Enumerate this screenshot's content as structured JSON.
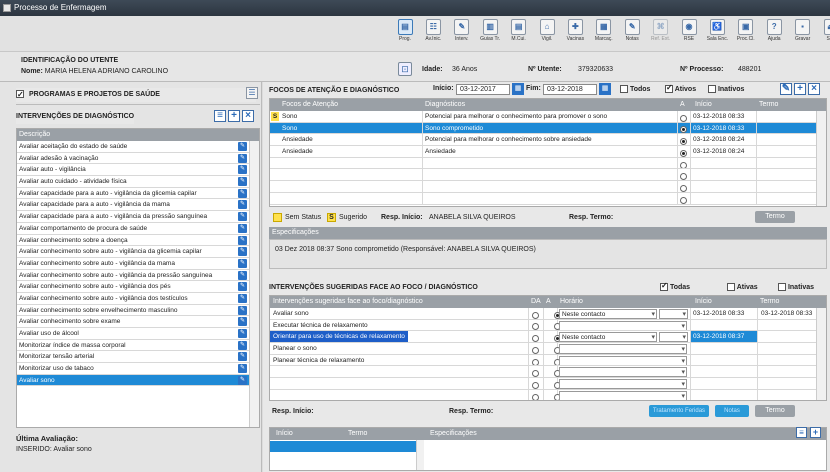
{
  "window": {
    "title": "Processo de Enfermagem"
  },
  "toolbar": [
    {
      "label": "Prog.",
      "icon": "program-icon",
      "state": "selected"
    },
    {
      "label": "Av.Inic.",
      "icon": "initial-eval-icon"
    },
    {
      "label": "Interv.",
      "icon": "interventions-icon"
    },
    {
      "label": "Guias Tr.",
      "icon": "guides-icon"
    },
    {
      "label": "M.Cui.",
      "icon": "care-model-icon"
    },
    {
      "label": "Vigil.",
      "icon": "vigilance-icon"
    },
    {
      "label": "Vacinas",
      "icon": "vaccine-icon"
    },
    {
      "label": "Marcaç.",
      "icon": "calendar-icon"
    },
    {
      "label": "Notas",
      "icon": "notes-icon"
    },
    {
      "label": "Ref. Ext.",
      "icon": "external-ref-icon",
      "state": "disabled"
    },
    {
      "label": "RSE",
      "icon": "rse-icon"
    },
    {
      "label": "Sala Enc.",
      "icon": "room-icon"
    },
    {
      "label": "Proc.Cl.",
      "icon": "clinical-process-icon"
    },
    {
      "label": "Ajuda",
      "icon": "help-icon"
    },
    {
      "label": "Gravar",
      "icon": "save-icon"
    },
    {
      "label": "Sair",
      "icon": "exit-icon"
    }
  ],
  "patient": {
    "section_title": "IDENTIFICAÇÃO DO UTENTE",
    "name_label": "Nome:",
    "name": "MARIA HELENA ADRIANO CAROLINO",
    "age_label": "Idade:",
    "age": "36 Anos",
    "utente_label": "Nº Utente:",
    "utente": "379320633",
    "processo_label": "Nº Processo:",
    "processo": "488201"
  },
  "left": {
    "programs_label": "PROGRAMAS E PROJETOS DE SAÚDE",
    "interventions_title": "INTERVENÇÕES DE DIAGNÓSTICO",
    "col_desc": "Descrição",
    "items": [
      "Avaliar aceitação do estado de saúde",
      "Avaliar adesão à vacinação",
      "Avaliar auto - vigilância",
      "Avaliar auto cuidado - atividade física",
      "Avaliar capacidade para a auto - vigilância da glicemia capilar",
      "Avaliar capacidade para a auto - vigilância da mama",
      "Avaliar capacidade para a auto - vigilância da pressão sanguínea",
      "Avaliar comportamento de procura de saúde",
      "Avaliar conhecimento sobre a doença",
      "Avaliar conhecimento sobre auto - vigilância da glicemia capilar",
      "Avaliar conhecimento sobre auto - vigilância da mama",
      "Avaliar conhecimento sobre auto - vigilância da pressão sanguínea",
      "Avaliar conhecimento sobre auto - vigilância dos pés",
      "Avaliar conhecimento sobre auto - vigilância dos testículos",
      "Avaliar conhecimento sobre envelhecimento masculino",
      "Avaliar conhecimento sobre exame",
      "Avaliar uso de álcool",
      "Monitorizar índice de massa corporal",
      "Monitorizar tensão arterial",
      "Monitorizar uso de tabaco",
      "Avaliar sono"
    ],
    "selected_index": 20,
    "last_eval_label": "Última Avaliação:",
    "last_eval_value": "INSERIDO: Avaliar sono"
  },
  "focos": {
    "title": "FOCOS DE ATENÇÃO E DIAGNÓSTICO",
    "inicio_label": "Início:",
    "inicio": "03-12-2017",
    "fim_label": "Fim:",
    "fim": "03-12-2018",
    "todos_label": "Todos",
    "ativos_label": "Ativos",
    "inativos_label": "Inativos",
    "cols": {
      "foco": "Focos de Atenção",
      "diag": "Diagnósticos",
      "a": "A",
      "inicio": "Início",
      "termo": "Termo"
    },
    "rows": [
      {
        "flag": "S",
        "foco": "Sono",
        "diag": "Potencial para melhorar o conhecimento para promover o sono",
        "active": false,
        "inicio": "03-12-2018 08:33",
        "termo": ""
      },
      {
        "flag": "",
        "foco": "Sono",
        "diag": "Sono comprometido",
        "active": true,
        "inicio": "03-12-2018 08:33",
        "termo": ""
      },
      {
        "flag": "",
        "foco": "Ansiedade",
        "diag": "Potencial para melhorar o conhecimento sobre ansiedade",
        "active": true,
        "inicio": "03-12-2018 08:24",
        "termo": ""
      },
      {
        "flag": "",
        "foco": "Ansiedade",
        "diag": "Ansiedade",
        "active": true,
        "inicio": "03-12-2018 08:24",
        "termo": ""
      }
    ],
    "selected_index": 1,
    "legend_sem": "Sem Status",
    "legend_sug": "Sugerido",
    "resp_inicio_label": "Resp. Início:",
    "resp_inicio": "ANABELA SILVA QUEIROS",
    "resp_termo_label": "Resp. Termo:",
    "termo_btn": "Termo",
    "espec_label": "Especificações",
    "espec_text": "03 Dez 2018 08:37  Sono comprometido  (Responsável: ANABELA SILVA QUEIROS)"
  },
  "sugeridas": {
    "title": "INTERVENÇÕES SUGERIDAS FACE AO FOCO / DIAGNÓSTICO",
    "todas_label": "Todas",
    "ativas_label": "Ativas",
    "inativas_label": "Inativas",
    "cols": {
      "desc": "Intervenções sugeridas face ao foco/diagnóstico",
      "da": "DA",
      "a": "A",
      "horario": "Horário",
      "inicio": "Início",
      "termo": "Termo"
    },
    "rows": [
      {
        "desc": "Avaliar sono",
        "horario": "Neste contacto",
        "inicio": "03-12-2018 08:33",
        "termo": "03-12-2018 08:33"
      },
      {
        "desc": "Executar técnica de relaxamento",
        "horario": "",
        "inicio": "",
        "termo": ""
      },
      {
        "desc": "Orientar para uso de técnicas de relaxamento",
        "horario": "Neste contacto",
        "inicio": "03-12-2018 08:37",
        "termo": ""
      },
      {
        "desc": "Planear o sono",
        "horario": "",
        "inicio": "",
        "termo": ""
      },
      {
        "desc": "Planear técnica de relaxamento",
        "horario": "",
        "inicio": "",
        "termo": ""
      }
    ],
    "selected_index": 2,
    "resp_inicio_label": "Resp. Início:",
    "resp_termo_label": "Resp. Termo:",
    "btn_ativ": "Tratamento Feridas",
    "btn_notas": "Notas",
    "btn_termo": "Termo"
  },
  "bottom": {
    "cols": {
      "inicio": "Início",
      "termo": "Termo",
      "espec": "Especificações"
    }
  },
  "colors": {
    "selection": "#1e8ad6",
    "header_gray": "#9aa0a6",
    "title_dark": "#2c3540"
  }
}
